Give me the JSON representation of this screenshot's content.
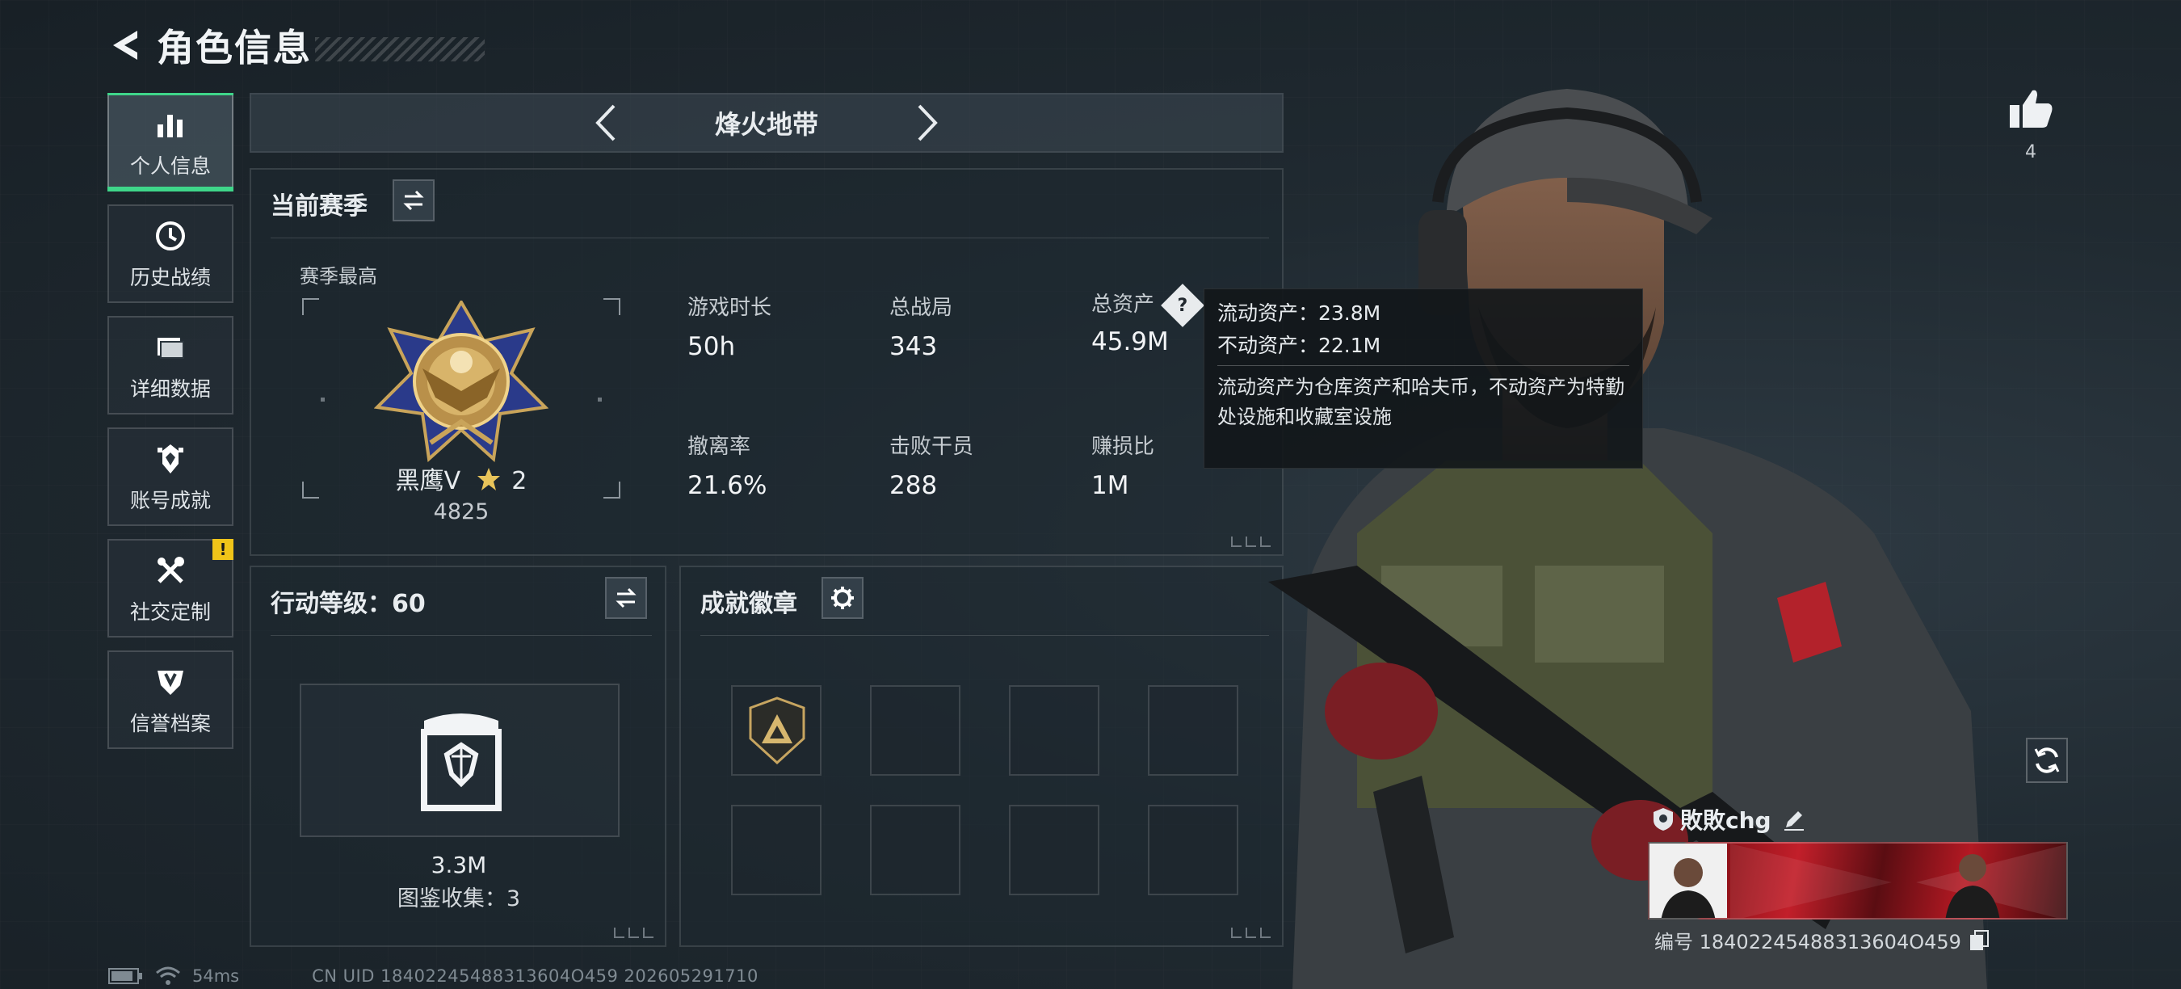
{
  "header": {
    "title": "角色信息"
  },
  "sidebar": {
    "items": [
      {
        "label": "个人信息",
        "icon": "bar-chart-icon",
        "active": true
      },
      {
        "label": "历史战绩",
        "icon": "clock-icon"
      },
      {
        "label": "详细数据",
        "icon": "folder-icon"
      },
      {
        "label": "账号成就",
        "icon": "achievement-icon"
      },
      {
        "label": "社交定制",
        "icon": "tools-icon",
        "alert": "!"
      },
      {
        "label": "信誉档案",
        "icon": "shield-icon"
      }
    ]
  },
  "mode": {
    "name": "烽火地带"
  },
  "season": {
    "title": "当前赛季",
    "best_label": "赛季最高",
    "rank_name": "黑鹰Ⅴ",
    "rank_stars": "2",
    "rank_points": "4825",
    "stats": [
      {
        "label": "游戏时长",
        "value": "50h"
      },
      {
        "label": "总战局",
        "value": "343"
      },
      {
        "label": "总资产",
        "value": "45.9M"
      },
      {
        "label": "撤离率",
        "value": "21.6%"
      },
      {
        "label": "击败干员",
        "value": "288"
      },
      {
        "label": "赚损比",
        "value": "1M"
      }
    ]
  },
  "tooltip": {
    "liquid": "流动资产：23.8M",
    "fixed": "不动资产：22.1M",
    "description": "流动资产为仓库资产和哈夫币，不动资产为特勤处设施和收藏室设施"
  },
  "level": {
    "title": "行动等级：60",
    "value": "3.3M",
    "collection": "图鉴收集：3"
  },
  "achievements": {
    "title": "成就徽章"
  },
  "player": {
    "likes": "4",
    "name": "敗敗chg",
    "id": "编号 18402245488313604O459"
  },
  "status": {
    "ping": "54ms",
    "uid": "CN UID 18402245488313604O459 202605291710"
  },
  "colors": {
    "accent": "#3fd68a",
    "alert": "#f0c419"
  }
}
